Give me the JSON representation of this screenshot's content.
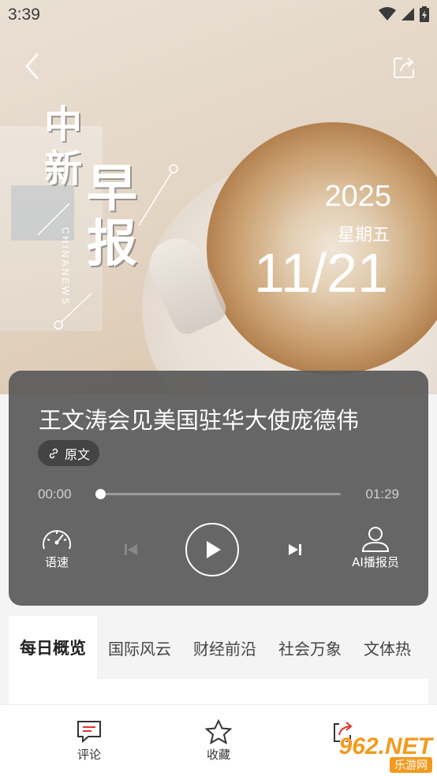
{
  "status_bar": {
    "time": "3:39"
  },
  "header": {
    "back_icon": "chevron-left-icon",
    "share_icon": "share-icon"
  },
  "logo": {
    "chars": [
      "中",
      "新",
      "早",
      "报"
    ],
    "en": "CHINANEWS"
  },
  "date": {
    "year": "2025",
    "weekday": "星期五",
    "day": "11/21"
  },
  "player": {
    "title": "王文涛会见美国驻华大使庞德伟",
    "source_label": "原文",
    "time_current": "00:00",
    "time_total": "01:29",
    "progress": 0.0,
    "speed_label": "语速",
    "anchor_label": "AI播报员"
  },
  "tabs": [
    {
      "label": "每日概览",
      "active": true
    },
    {
      "label": "国际风云",
      "active": false
    },
    {
      "label": "财经前沿",
      "active": false
    },
    {
      "label": "社会万象",
      "active": false
    },
    {
      "label": "文体热",
      "active": false
    }
  ],
  "bottom_bar": {
    "comment_label": "评论",
    "favorite_label": "收藏"
  },
  "watermark": {
    "main": "962.NET",
    "sub": "乐游网"
  },
  "colors": {
    "player_bg": "#5a5a5a",
    "watermark": "#f39a1e"
  }
}
